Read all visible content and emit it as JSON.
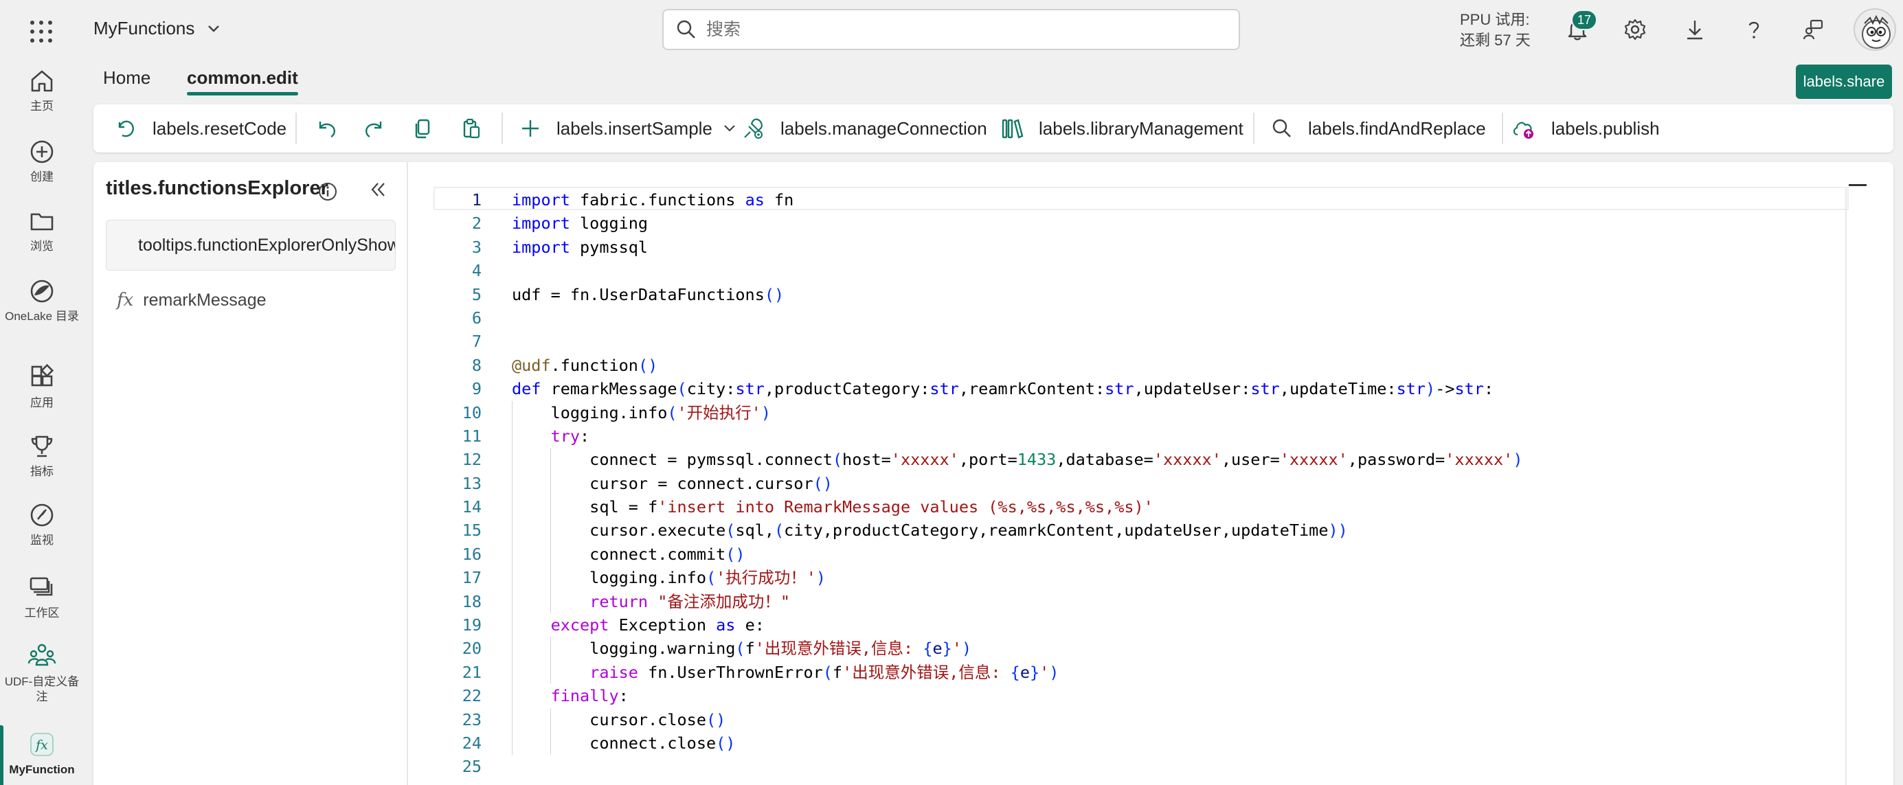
{
  "rail": {
    "items": [
      {
        "label": "主页",
        "icon": "home-icon"
      },
      {
        "label": "创建",
        "icon": "create-plus-icon"
      },
      {
        "label": "浏览",
        "icon": "folder-icon"
      },
      {
        "label": "OneLake 目录",
        "icon": "onelake-icon"
      },
      {
        "label": "应用",
        "icon": "apps-icon"
      },
      {
        "label": "指标",
        "icon": "trophy-icon"
      },
      {
        "label": "监视",
        "icon": "monitor-icon"
      },
      {
        "label": "工作区",
        "icon": "workspaces-icon"
      },
      {
        "label": "UDF-自定义备注",
        "icon": "workspace-people-icon"
      },
      {
        "label": "MyFunction",
        "icon": "function-icon"
      }
    ]
  },
  "header": {
    "app_name": "MyFunctions",
    "search_placeholder": "搜索",
    "trial_line1": "PPU 试用:",
    "trial_line2": "还剩 57 天",
    "notification_count": "17"
  },
  "tabs": [
    {
      "label": "Home",
      "active": false
    },
    {
      "label": "common.edit",
      "active": true
    }
  ],
  "share_label": "labels.share",
  "toolbar": {
    "reset_code": "labels.resetCode",
    "insert_sample": "labels.insertSample",
    "manage_connection": "labels.manageConnection",
    "library_management": "labels.libraryManagement",
    "find_and_replace": "labels.findAndReplace",
    "publish": "labels.publish"
  },
  "explorer": {
    "title": "titles.functionsExplorer",
    "banner": "tooltips.functionExplorerOnlyShow",
    "function_name": "remarkMessage"
  },
  "editor": {
    "current_line": 1,
    "lines": [
      "import fabric.functions as fn",
      "import logging",
      "import pymssql",
      "",
      "udf = fn.UserDataFunctions()",
      "",
      "",
      "@udf.function()",
      "def remarkMessage(city:str,productCategory:str,reamrkContent:str,updateUser:str,updateTime:str)->str:",
      "    logging.info('开始执行')",
      "    try:",
      "        connect = pymssql.connect(host='xxxxx',port=1433,database='xxxxx',user='xxxxx',password='xxxxx')",
      "        cursor = connect.cursor()",
      "        sql = f'insert into RemarkMessage values (%s,%s,%s,%s,%s)'",
      "        cursor.execute(sql,(city,productCategory,reamrkContent,updateUser,updateTime))",
      "        connect.commit()",
      "        logging.info('执行成功！')",
      "        return \"备注添加成功！\"",
      "    except Exception as e:",
      "        logging.warning(f'出现意外错误,信息: {e}')",
      "        raise fn.UserThrownError(f'出现意外错误,信息: {e}')",
      "    finally:",
      "        cursor.close()",
      "        connect.close()",
      ""
    ]
  },
  "colors": {
    "accent": "#117865",
    "keyword": "#0000ff",
    "control": "#af00db",
    "string": "#a31515",
    "number": "#098658",
    "line_number": "#237893"
  }
}
